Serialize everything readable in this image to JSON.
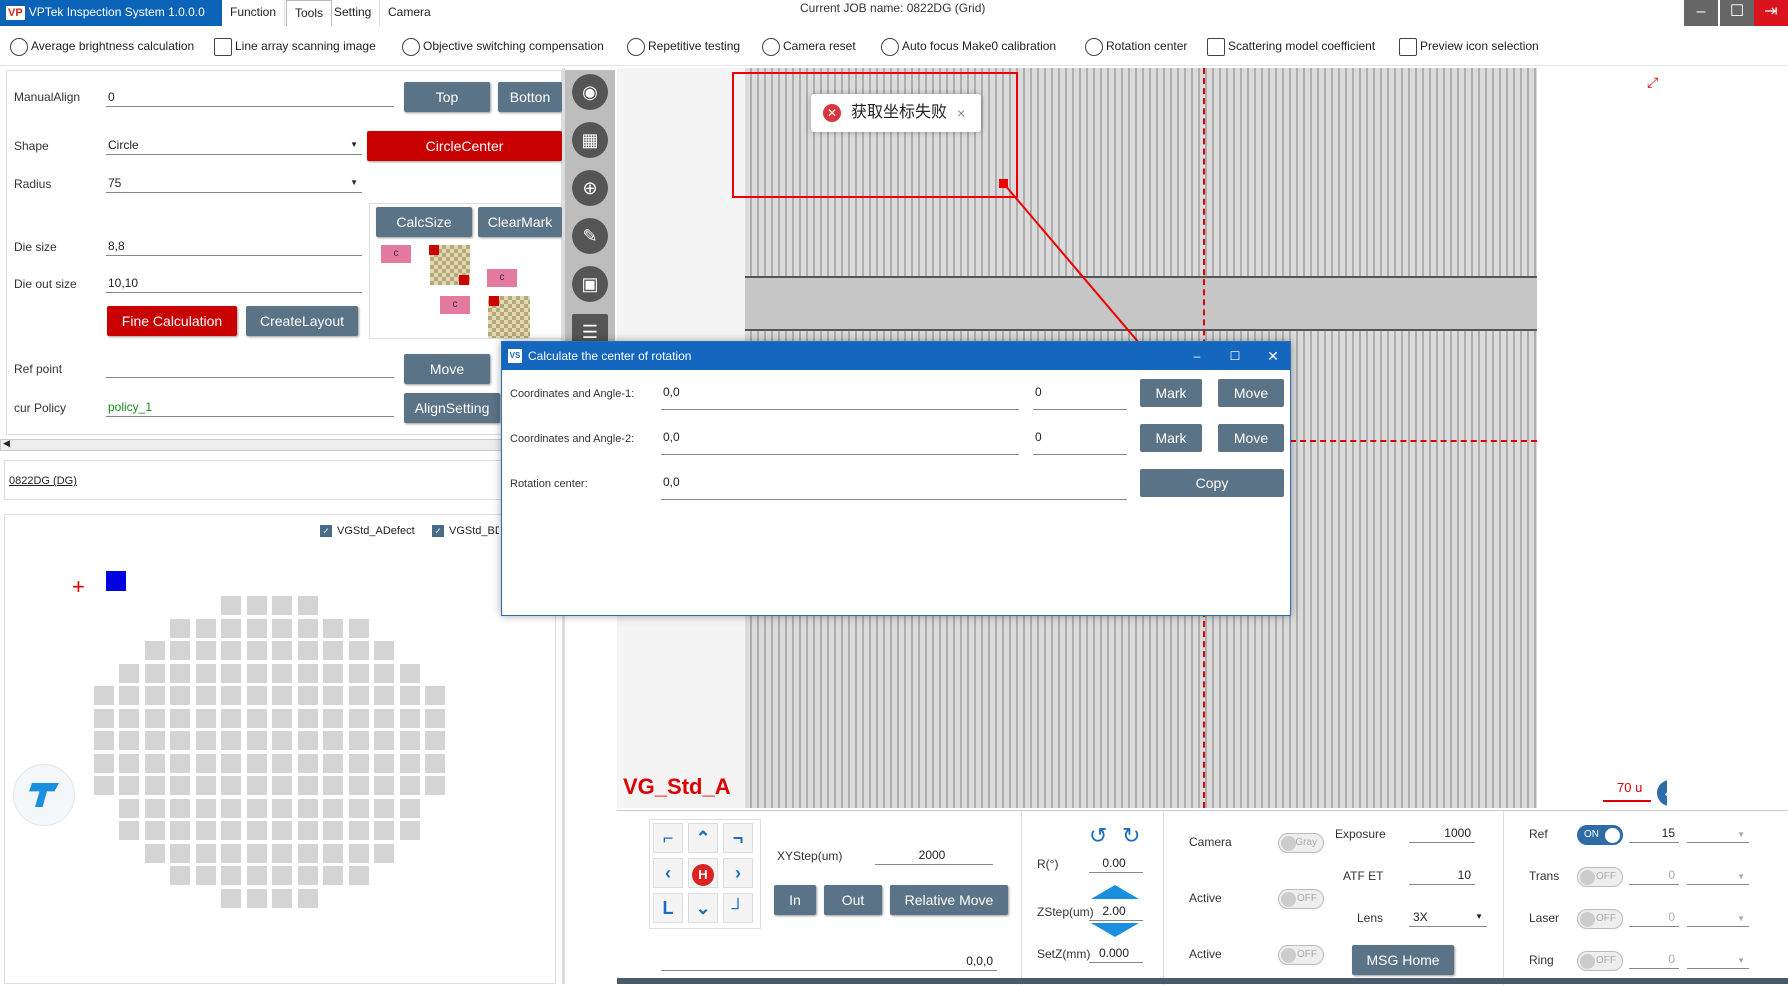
{
  "app": {
    "logo_text": "VP",
    "title": "VPTek Inspection System 1.0.0.0"
  },
  "menu": [
    "Function",
    "Tools",
    "Setting",
    "Camera"
  ],
  "job_title": "Current JOB name:  0822DG (Grid)",
  "toolbar": [
    "Average brightness calculation",
    "Line array scanning image",
    "Objective switching compensation",
    "Repetitive testing",
    "Camera reset",
    "Auto focus Make0 calibration",
    "Rotation center",
    "Scattering model coefficient",
    "Preview icon selection"
  ],
  "left": {
    "manual_align_label": "ManualAlign",
    "manual_align_value": "0",
    "top_btn": "Top",
    "bottom_btn": "Botton",
    "shape_label": "Shape",
    "shape_value": "Circle",
    "circlecenter_btn": "CircleCenter",
    "radius_label": "Radius",
    "radius_value": "75",
    "calcsize_btn": "CalcSize",
    "clearmark_btn": "ClearMark",
    "die_size_label": "Die size",
    "die_size_value": "8,8",
    "die_out_label": "Die out size",
    "die_out_value": "10,10",
    "fine_calc_btn": "Fine Calculation",
    "create_layout_btn": "CreateLayout",
    "ref_point_label": "Ref point",
    "ref_point_value": "",
    "move_btn": "Move",
    "policy_label": "cur Policy",
    "policy_value": "policy_1",
    "align_btn": "AlignSetting",
    "c_label": "c",
    "job_link": "0822DG (DG)",
    "check1": "VGStd_ADefect",
    "check2": "VGStd_BD"
  },
  "view": {
    "overlay_label": "VG_Std_A",
    "scale_label": "70 u"
  },
  "toast": {
    "text": "获取坐标失败"
  },
  "dialog": {
    "title": "Calculate the center of rotation",
    "row1_label": "Coordinates and Angle-1:",
    "row1_coord": "0,0",
    "row1_angle": "0",
    "row2_label": "Coordinates and Angle-2:",
    "row2_coord": "0,0",
    "row2_angle": "0",
    "row3_label": "Rotation center:",
    "row3_value": "0,0",
    "mark": "Mark",
    "move": "Move",
    "copy": "Copy"
  },
  "bottom": {
    "xystep_label": "XYStep(um)",
    "xystep_value": "2000",
    "in_btn": "In",
    "out_btn": "Out",
    "relmove_btn": "Relative Move",
    "coord_value": "0,0,0",
    "r_label": "R(°)",
    "r_value": "0.00",
    "zstep_label": "ZStep(um)",
    "zstep_value": "2.00",
    "setz_label": "SetZ(mm)",
    "setz_value": "0.000",
    "camera_label": "Camera",
    "camera_toggle": "Gray",
    "active1_label": "Active",
    "active2_label": "Active",
    "off": "OFF",
    "on": "ON",
    "exposure_label": "Exposure",
    "exposure_value": "1000",
    "atf_label": "ATF ET",
    "atf_value": "10",
    "lens_label": "Lens",
    "lens_value": "3X",
    "msg_btn": "MSG Home",
    "ref_label": "Ref",
    "ref_value": "15",
    "trans_label": "Trans",
    "trans_value": "0",
    "laser_label": "Laser",
    "laser_value": "0",
    "ring_label": "Ring",
    "ring_value": "0",
    "home_glyph": "H"
  }
}
